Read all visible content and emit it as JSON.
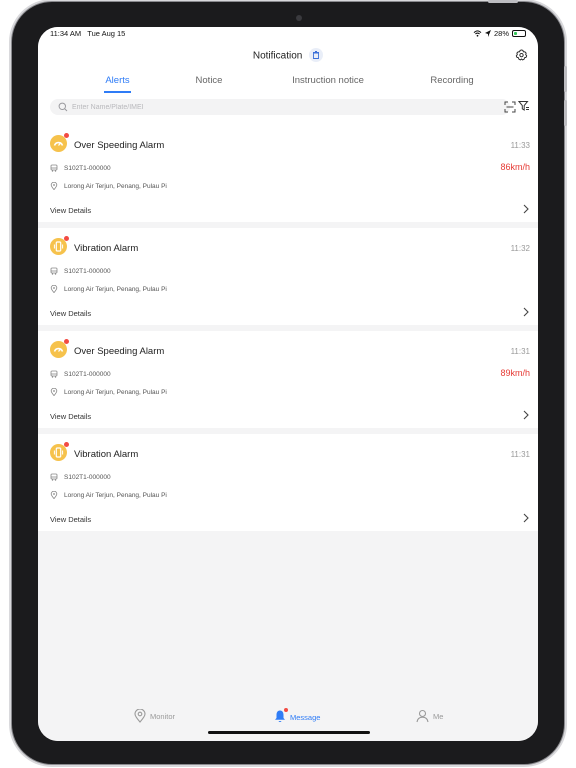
{
  "status_bar": {
    "time": "11:34 AM",
    "date": "Tue Aug 15",
    "battery": "28%",
    "battery_level": 0.28
  },
  "header": {
    "title": "Notification"
  },
  "tabs": [
    {
      "label": "Alerts",
      "active": true
    },
    {
      "label": "Notice",
      "active": false
    },
    {
      "label": "Instruction notice",
      "active": false
    },
    {
      "label": "Recording",
      "active": false
    }
  ],
  "search": {
    "placeholder": "Enter Name/Plate/IMEI"
  },
  "alerts": [
    {
      "name": "Over Speeding Alarm",
      "time": "11:33",
      "vehicle": "S102T1-000000",
      "location": "Lorong Air Terjun, Penang, Pulau Pi",
      "speed": "86km/h",
      "icon": "speedometer-icon",
      "action": "View Details"
    },
    {
      "name": "Vibration Alarm",
      "time": "11:32",
      "vehicle": "S102T1-000000",
      "location": "Lorong Air Terjun, Penang, Pulau Pi",
      "speed": "",
      "icon": "vibration-icon",
      "action": "View Details"
    },
    {
      "name": "Over Speeding Alarm",
      "time": "11:31",
      "vehicle": "S102T1-000000",
      "location": "Lorong Air Terjun, Penang, Pulau Pi",
      "speed": "89km/h",
      "icon": "speedometer-icon",
      "action": "View Details"
    },
    {
      "name": "Vibration Alarm",
      "time": "11:31",
      "vehicle": "S102T1-000000",
      "location": "Lorong Air Terjun, Penang, Pulau Pi",
      "speed": "",
      "icon": "vibration-icon",
      "action": "View Details"
    }
  ],
  "bottom_nav": [
    {
      "label": "Monitor",
      "icon": "location-pin-icon",
      "active": false
    },
    {
      "label": "Message",
      "icon": "bell-icon",
      "active": true
    },
    {
      "label": "Me",
      "icon": "person-icon",
      "active": false
    }
  ],
  "colors": {
    "accent": "#2f7cf6",
    "speed_alert": "#e63b35",
    "alarm_icon": "#f6c24c",
    "badge": "#f24b43"
  }
}
